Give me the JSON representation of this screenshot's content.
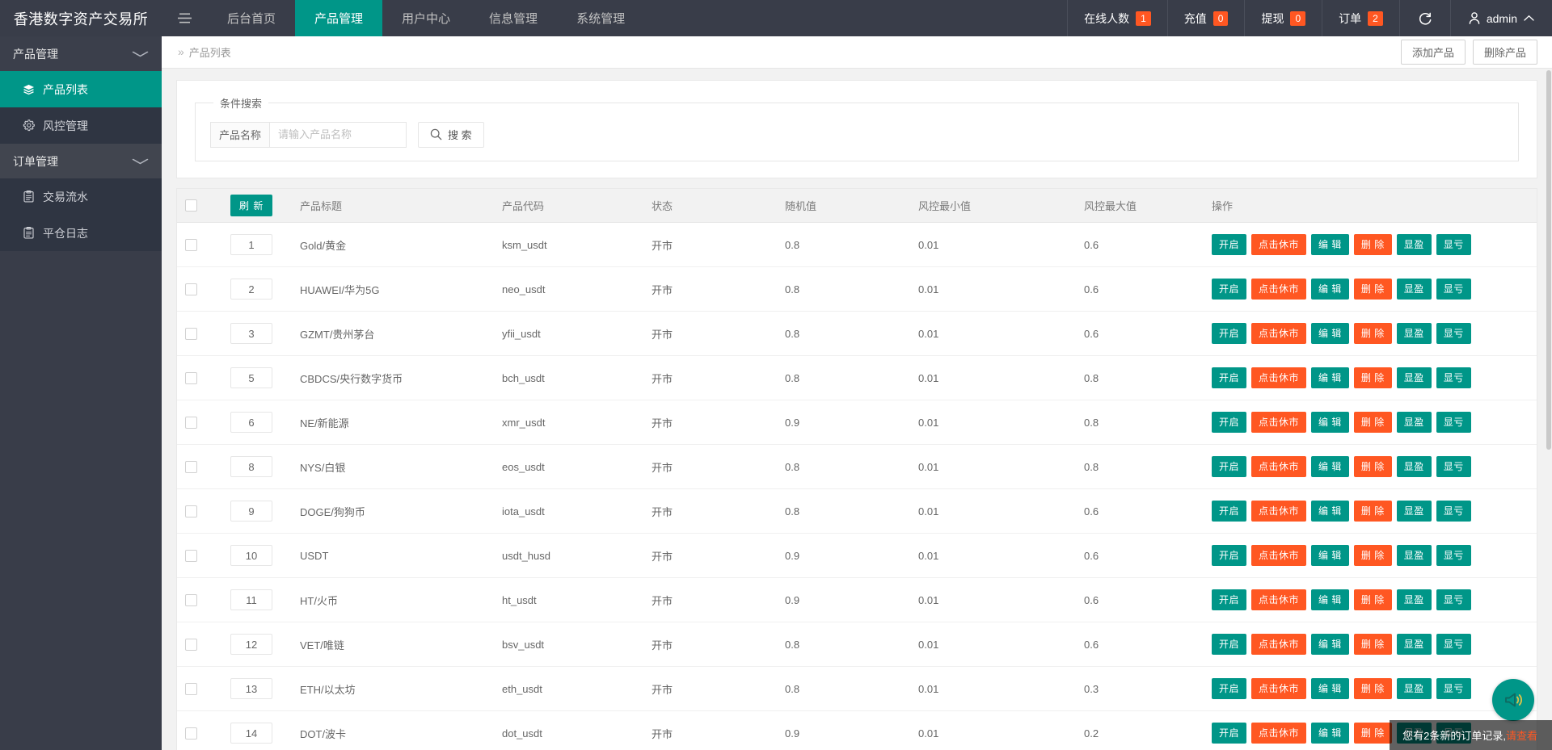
{
  "topnav": {
    "brand": "香港数字资产交易所",
    "hamburger_icon": "menu-icon",
    "items": [
      {
        "label": "后台首页",
        "active": false
      },
      {
        "label": "产品管理",
        "active": true
      },
      {
        "label": "用户中心",
        "active": false
      },
      {
        "label": "信息管理",
        "active": false
      },
      {
        "label": "系统管理",
        "active": false
      }
    ],
    "stats": [
      {
        "label": "在线人数",
        "count": "1"
      },
      {
        "label": "充值",
        "count": "0"
      },
      {
        "label": "提现",
        "count": "0"
      },
      {
        "label": "订单",
        "count": "2"
      }
    ],
    "refresh_icon": "refresh-icon",
    "user": {
      "name": "admin",
      "avatar_icon": "user-icon",
      "caret_icon": "chevron-up-icon"
    },
    "badge_color": "#FF5722",
    "accent_color": "#009688",
    "bar_color": "#393d49"
  },
  "sidebar": {
    "groups": [
      {
        "label": "产品管理",
        "chevron_icon": "chevron-down-icon",
        "items": [
          {
            "label": "产品列表",
            "icon": "layers-icon",
            "active": true
          },
          {
            "label": "风控管理",
            "icon": "gear-icon",
            "active": false
          }
        ]
      },
      {
        "label": "订单管理",
        "chevron_icon": "chevron-down-icon",
        "items": [
          {
            "label": "交易流水",
            "icon": "clipboard-icon",
            "active": false
          },
          {
            "label": "平仓日志",
            "icon": "clipboard-icon",
            "active": false
          }
        ]
      }
    ]
  },
  "breadcrumb": {
    "arrows": "»",
    "current": "产品列表",
    "actions": [
      {
        "label": "添加产品"
      },
      {
        "label": "删除产品"
      }
    ]
  },
  "search_panel": {
    "legend": "条件搜索",
    "field_label": "产品名称",
    "field_value": "",
    "field_placeholder": "请输入产品名称",
    "search_button": "搜 索",
    "search_icon": "search-icon"
  },
  "table": {
    "refresh_button": "刷 新",
    "columns": [
      "产品标题",
      "产品代码",
      "状态",
      "随机值",
      "风控最小值",
      "风控最大值",
      "操作"
    ],
    "row_actions": [
      {
        "label": "开启",
        "style": "teal"
      },
      {
        "label": "点击休市",
        "style": "orange"
      },
      {
        "label": "编 辑",
        "style": "teal"
      },
      {
        "label": "删 除",
        "style": "orange"
      },
      {
        "label": "显盈",
        "style": "teal"
      },
      {
        "label": "显亏",
        "style": "teal"
      }
    ],
    "rows": [
      {
        "id": "1",
        "title": "Gold/黄金",
        "code": "ksm_usdt",
        "state": "开市",
        "rand": "0.8",
        "min": "0.01",
        "max": "0.6"
      },
      {
        "id": "2",
        "title": "HUAWEI/华为5G",
        "code": "neo_usdt",
        "state": "开市",
        "rand": "0.8",
        "min": "0.01",
        "max": "0.6"
      },
      {
        "id": "3",
        "title": "GZMT/贵州茅台",
        "code": "yfii_usdt",
        "state": "开市",
        "rand": "0.8",
        "min": "0.01",
        "max": "0.6"
      },
      {
        "id": "5",
        "title": "CBDCS/央行数字货币",
        "code": "bch_usdt",
        "state": "开市",
        "rand": "0.8",
        "min": "0.01",
        "max": "0.8"
      },
      {
        "id": "6",
        "title": "NE/新能源",
        "code": "xmr_usdt",
        "state": "开市",
        "rand": "0.9",
        "min": "0.01",
        "max": "0.8"
      },
      {
        "id": "8",
        "title": "NYS/白银",
        "code": "eos_usdt",
        "state": "开市",
        "rand": "0.8",
        "min": "0.01",
        "max": "0.8"
      },
      {
        "id": "9",
        "title": "DOGE/狗狗币",
        "code": "iota_usdt",
        "state": "开市",
        "rand": "0.8",
        "min": "0.01",
        "max": "0.6"
      },
      {
        "id": "10",
        "title": "USDT",
        "code": "usdt_husd",
        "state": "开市",
        "rand": "0.9",
        "min": "0.01",
        "max": "0.6"
      },
      {
        "id": "11",
        "title": "HT/火币",
        "code": "ht_usdt",
        "state": "开市",
        "rand": "0.9",
        "min": "0.01",
        "max": "0.6"
      },
      {
        "id": "12",
        "title": "VET/唯链",
        "code": "bsv_usdt",
        "state": "开市",
        "rand": "0.8",
        "min": "0.01",
        "max": "0.6"
      },
      {
        "id": "13",
        "title": "ETH/以太坊",
        "code": "eth_usdt",
        "state": "开市",
        "rand": "0.8",
        "min": "0.01",
        "max": "0.3"
      },
      {
        "id": "14",
        "title": "DOT/波卡",
        "code": "dot_usdt",
        "state": "开市",
        "rand": "0.9",
        "min": "0.01",
        "max": "0.2"
      }
    ]
  },
  "toast": {
    "message": "您有2条新的订单记录,",
    "link": "请查看"
  },
  "fab": {
    "icon": "megaphone-icon"
  }
}
